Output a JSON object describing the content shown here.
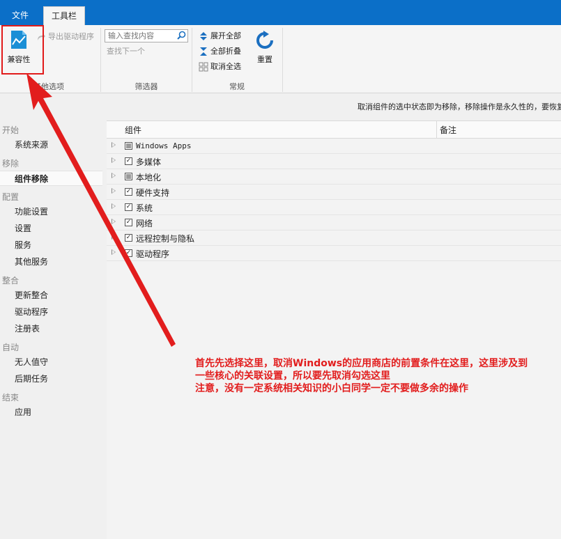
{
  "tabs": [
    {
      "label": "文件"
    },
    {
      "label": "工具栏"
    }
  ],
  "ribbon": {
    "compat_label": "兼容性",
    "export_drivers_label": "导出驱动程序",
    "group_other": "其他选项",
    "search_placeholder": "输入查找内容",
    "find_next_label": "查找下一个",
    "group_filter": "筛选器",
    "expand_all_label": "展开全部",
    "collapse_all_label": "全部折叠",
    "deselect_all_label": "取消全选",
    "group_general": "常规",
    "reset_label": "重置"
  },
  "info_text": "取消组件的选中状态即为移除，移除操作是永久性的，要恢复",
  "sidebar": {
    "sections": [
      {
        "title": "开始",
        "items": [
          "系统来源"
        ]
      },
      {
        "title": "移除",
        "items": [
          "组件移除"
        ]
      },
      {
        "title": "配置",
        "items": [
          "功能设置",
          "设置",
          "服务",
          "其他服务"
        ]
      },
      {
        "title": "整合",
        "items": [
          "更新整合",
          "驱动程序",
          "注册表"
        ]
      },
      {
        "title": "自动",
        "items": [
          "无人值守",
          "后期任务"
        ]
      },
      {
        "title": "结束",
        "items": [
          "应用"
        ]
      }
    ],
    "active": "组件移除"
  },
  "list": {
    "columns": [
      "组件",
      "备注"
    ],
    "rows": [
      {
        "name": "Windows Apps",
        "state": "partial"
      },
      {
        "name": "多媒体",
        "state": "checked"
      },
      {
        "name": "本地化",
        "state": "partial"
      },
      {
        "name": "硬件支持",
        "state": "checked"
      },
      {
        "name": "系统",
        "state": "checked"
      },
      {
        "name": "网络",
        "state": "checked"
      },
      {
        "name": "远程控制与隐私",
        "state": "checked"
      },
      {
        "name": "驱动程序",
        "state": "checked"
      }
    ]
  },
  "annotation": {
    "line1": "首先先选择这里，取消Windows的应用商店的前置条件在这里，这里涉及到",
    "line2": "一些核心的关联设置，所以要先取消勾选这里",
    "line3": "注意，没有一定系统相关知识的小白同学一定不要做多余的操作"
  },
  "colors": {
    "accent": "#0b6fc8",
    "annotation": "#e21d1d"
  }
}
